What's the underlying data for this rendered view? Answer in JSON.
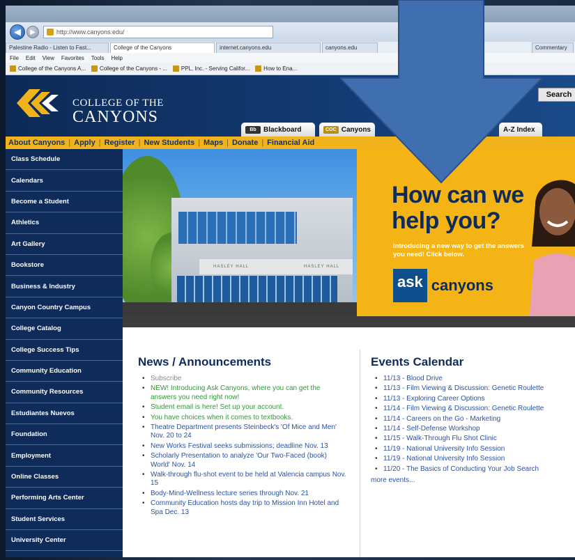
{
  "browser": {
    "url": "http://www.canyons.edu/",
    "tabs": [
      "Palestine Radio - Listen to Fast...",
      "College of the Canyons",
      "internet.canyons.edu",
      "canyons.edu",
      "Commentary"
    ],
    "menu": [
      "File",
      "Edit",
      "View",
      "Favorites",
      "Tools",
      "Help"
    ],
    "favorites": [
      "College of the Canyons A...",
      "College of the Canyons - ...",
      "PPL, Inc. - Serving Califor...",
      "How to Ena..."
    ]
  },
  "site": {
    "logo_line1": "COLLEGE OF THE",
    "logo_line2": "CANYONS",
    "search_label": "Search",
    "header_tabs": [
      {
        "icon": "Bb",
        "label": "Blackboard"
      },
      {
        "icon": "COC",
        "label": "Canyons"
      },
      {
        "icon": "",
        "label": "A-Z Index"
      }
    ],
    "top_nav": [
      "About Canyons",
      "Apply",
      "Register",
      "New Students",
      "Maps",
      "Donate",
      "Financial Aid"
    ],
    "left_nav": [
      "Class Schedule",
      "Calendars",
      "Become a Student",
      "Athletics",
      "Art Gallery",
      "Bookstore",
      "Business & Industry",
      "Canyon Country Campus",
      "College Catalog",
      "College Success Tips",
      "Community Education",
      "Community Resources",
      "Estudiantes Nuevos",
      "Foundation",
      "Employment",
      "Online Classes",
      "Performing Arts Center",
      "Student Services",
      "University Center"
    ],
    "hero": {
      "headline": "How can we help you?",
      "intro": "Introducing a new way to get the answers you need! Click below.",
      "ask_logo": {
        "ask": "ask",
        "canyons": "canyons"
      },
      "building_sign_1": "HASLEY HALL",
      "building_sign_2": "HASLEY HALL"
    },
    "news": {
      "title": "News / Announcements",
      "items": [
        {
          "text": "Subscribe",
          "style": "subscribe"
        },
        {
          "text": "NEW! Introducing Ask Canyons, where you can get the answers you need right now!",
          "style": "green"
        },
        {
          "text": "Student email is here! Set up your account.",
          "style": "green"
        },
        {
          "text": "You have choices when it comes to textbooks.",
          "style": "green"
        },
        {
          "text": "Theatre Department presents Steinbeck's 'Of Mice and Men' Nov. 20 to 24",
          "style": "blue"
        },
        {
          "text": "New Works Festival seeks submissions; deadline Nov. 13",
          "style": "blue"
        },
        {
          "text": "Scholarly Presentation to analyze 'Our Two-Faced (book) World' Nov. 14",
          "style": "blue"
        },
        {
          "text": "Walk-through flu-shot event to be held at Valencia campus Nov. 15",
          "style": "blue"
        },
        {
          "text": "Body-Mind-Wellness lecture series through Nov. 21",
          "style": "blue"
        },
        {
          "text": "Community Education hosts day trip to Mission Inn Hotel and Spa Dec. 13",
          "style": "blue"
        }
      ]
    },
    "events": {
      "title": "Events Calendar",
      "items": [
        "11/13 - Blood Drive",
        "11/13 - Film Viewing & Discussion: Genetic Roulette",
        "11/13 - Exploring Career Options",
        "11/14 - Film Viewing & Discussion: Genetic Roulette",
        "11/14 - Careers on the Go - Marketing",
        "11/14 - Self-Defense Workshop",
        "11/15 - Walk-Through Flu Shot Clinic",
        "11/19 - National University Info Session",
        "11/19 - National University Info Session",
        "11/20 - The Basics of Conducting Your Job Search"
      ],
      "more": "more events..."
    }
  },
  "overlay": {
    "shape": "down-arrow",
    "color": "#3f6fb0"
  },
  "colors": {
    "navy": "#0e2b5a",
    "gold": "#f0b31c",
    "link": "#2a53a3",
    "green": "#2f9a36"
  }
}
